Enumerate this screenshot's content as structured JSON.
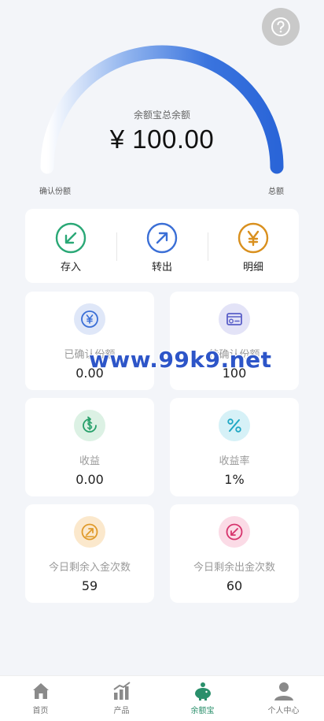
{
  "gauge": {
    "title": "余额宝总余额",
    "amount": "¥ 100.00",
    "left_label": "确认份额",
    "right_label": "总额"
  },
  "actions": [
    {
      "label": "存入",
      "icon": "arrow-down-left-icon",
      "color": "#2aa876"
    },
    {
      "label": "转出",
      "icon": "arrow-up-right-icon",
      "color": "#3b6fd6"
    },
    {
      "label": "明细",
      "icon": "yen-icon",
      "color": "#d9901e"
    }
  ],
  "cards": [
    {
      "label": "已确认份额",
      "value": "0.00",
      "icon": "yen-coin-icon"
    },
    {
      "label": "待确认份额",
      "value": "100",
      "icon": "wallet-card-icon"
    },
    {
      "label": "收益",
      "value": "0.00",
      "icon": "dollar-refresh-icon"
    },
    {
      "label": "收益率",
      "value": "1%",
      "icon": "percent-icon"
    },
    {
      "label": "今日剩余入金次数",
      "value": "59",
      "icon": "deposit-count-icon"
    },
    {
      "label": "今日剩余出金次数",
      "value": "60",
      "icon": "withdraw-count-icon"
    }
  ],
  "watermark": "www.99k9.net",
  "tabs": [
    {
      "label": "首页",
      "icon": "home-icon"
    },
    {
      "label": "产品",
      "icon": "chart-bars-icon"
    },
    {
      "label": "余额宝",
      "icon": "piggy-bank-icon"
    },
    {
      "label": "个人中心",
      "icon": "user-icon"
    }
  ],
  "colors": {
    "accent": "#2d6cdf",
    "active_tab": "#2a8f6b",
    "background": "#f3f5f9"
  }
}
